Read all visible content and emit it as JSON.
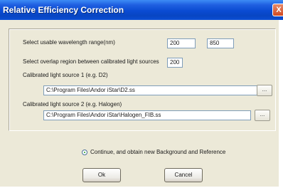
{
  "window": {
    "title": "Relative Efficiency Correction",
    "close_glyph": "X"
  },
  "wavelength": {
    "label": "Select usable wavelength range(nm)",
    "min": "200",
    "max": "850"
  },
  "overlap": {
    "label": "Select overlap region between calibrated light sources",
    "value": "200"
  },
  "source1": {
    "label": "Calibrated light source 1 (e.g. D2)",
    "path": "C:\\Program Files\\Andor iStar\\D2.ss",
    "browse_label": "..."
  },
  "source2": {
    "label": "Calibrated light source 2 (e.g. Halogen)",
    "path": "C:\\Program Files\\Andor iStar\\Halogen_FIB.ss",
    "browse_label": "..."
  },
  "option": {
    "label": "Continue, and obtain new Background and Reference",
    "selected": true
  },
  "buttons": {
    "ok": "Ok",
    "cancel": "Cancel"
  },
  "colors": {
    "title_bar": "#0a4bd2",
    "dialog_bg": "#ece9d8",
    "close_button": "#d24a22"
  }
}
